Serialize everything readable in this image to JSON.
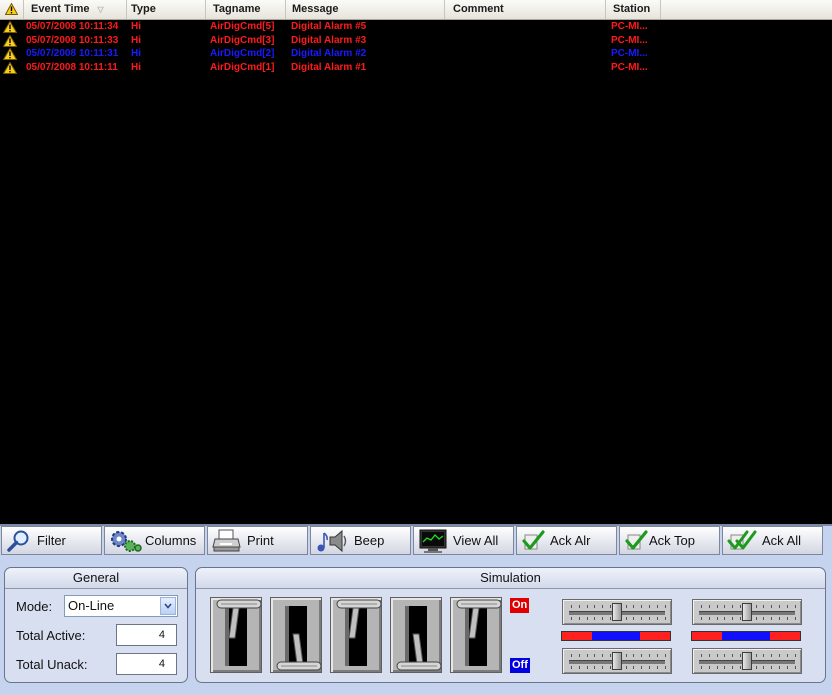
{
  "grid": {
    "columns": [
      "Event Time",
      "Type",
      "Tagname",
      "Message",
      "Comment",
      "Station"
    ],
    "rows": [
      {
        "time": "05/07/2008 10:11:34",
        "type": "Hi",
        "tag": "AirDigCmd[5]",
        "message": "Digital Alarm #5",
        "comment": "",
        "station": "PC-MI...",
        "color": "#ff1a1a"
      },
      {
        "time": "05/07/2008 10:11:33",
        "type": "Hi",
        "tag": "AirDigCmd[3]",
        "message": "Digital Alarm #3",
        "comment": "",
        "station": "PC-MI...",
        "color": "#ff1a1a"
      },
      {
        "time": "05/07/2008 10:11:31",
        "type": "Hi",
        "tag": "AirDigCmd[2]",
        "message": "Digital Alarm #2",
        "comment": "",
        "station": "PC-MI...",
        "color": "#1a1aff"
      },
      {
        "time": "05/07/2008 10:11:11",
        "type": "Hi",
        "tag": "AirDigCmd[1]",
        "message": "Digital Alarm #1",
        "comment": "",
        "station": "PC-MI...",
        "color": "#ff1a1a"
      }
    ]
  },
  "toolbar": {
    "buttons": [
      {
        "label": "Filter",
        "icon": "magnifier-icon"
      },
      {
        "label": "Columns",
        "icon": "gears-icon"
      },
      {
        "label": "Print",
        "icon": "printer-icon"
      },
      {
        "label": "Beep",
        "icon": "speaker-icon"
      },
      {
        "label": "View All",
        "icon": "monitor-icon"
      },
      {
        "label": "Ack Alr",
        "icon": "checkmark-icon"
      },
      {
        "label": "Ack Top",
        "icon": "checkmark-icon"
      },
      {
        "label": "Ack All",
        "icon": "double-checkmark-icon"
      }
    ]
  },
  "general": {
    "title": "General",
    "mode_label": "Mode:",
    "mode_value": "On-Line",
    "total_active_label": "Total Active:",
    "total_active_value": "4",
    "total_unack_label": "Total Unack:",
    "total_unack_value": "4"
  },
  "simulation": {
    "title": "Simulation",
    "on_label": "On",
    "off_label": "Off",
    "switches": [
      "up",
      "down",
      "up",
      "down",
      "up"
    ],
    "sliders_left": [
      0.5,
      0.5
    ],
    "sliders_right": [
      0.5,
      0.5
    ],
    "colors": {
      "on": "#e00000",
      "off": "#0000e0",
      "bar_red": "#ff2020",
      "bar_blue": "#1010ff"
    }
  }
}
